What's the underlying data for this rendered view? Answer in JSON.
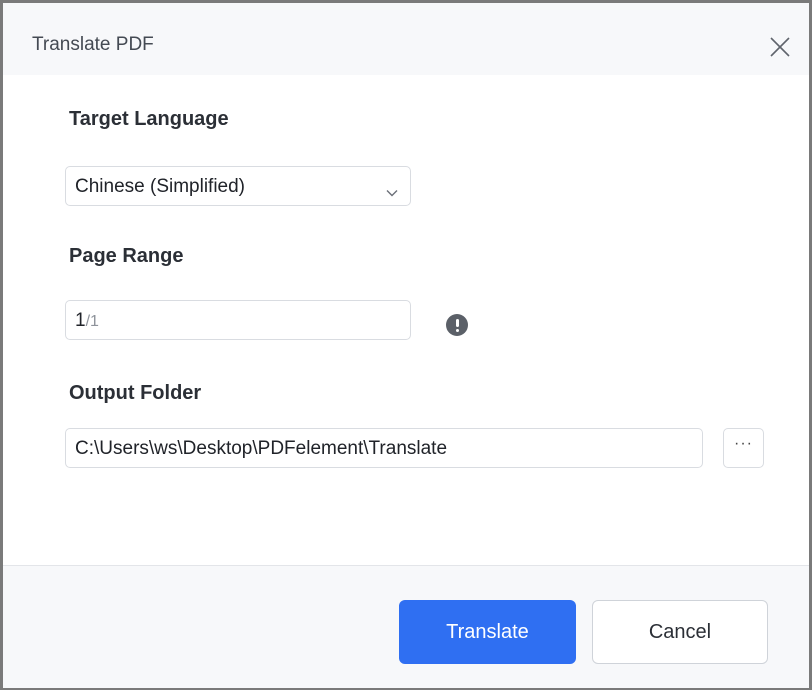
{
  "dialog": {
    "title": "Translate PDF"
  },
  "target_language": {
    "label": "Target Language",
    "selected": "Chinese (Simplified)"
  },
  "page_range": {
    "label": "Page Range",
    "value": "1",
    "total": "/1"
  },
  "output_folder": {
    "label": "Output Folder",
    "path": "C:\\Users\\ws\\Desktop\\PDFelement\\Translate",
    "browse_label": "···"
  },
  "buttons": {
    "translate": "Translate",
    "cancel": "Cancel"
  },
  "colors": {
    "primary": "#2f6ff2",
    "info_icon": "#5b6068"
  },
  "icons": {
    "close": "close-icon",
    "dropdown": "chevron-down-icon",
    "info": "exclamation-info-icon",
    "browse": "more-dots-icon"
  }
}
